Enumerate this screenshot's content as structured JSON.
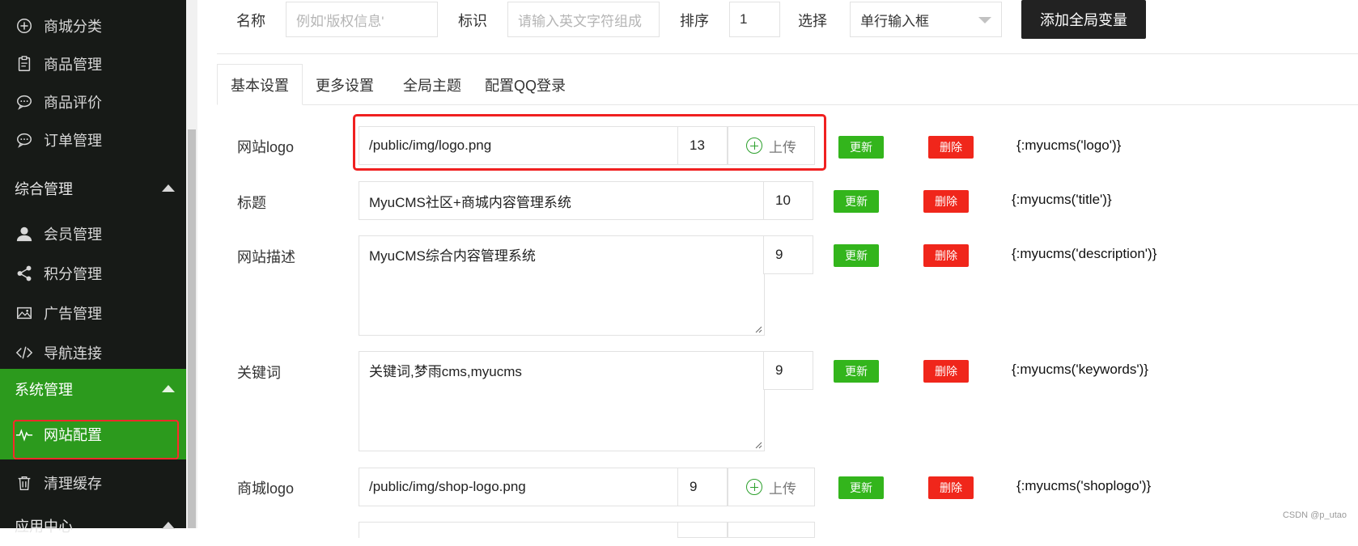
{
  "sidebar": {
    "items_top": [
      {
        "label": "商城分类",
        "icon": "plus-circle-icon"
      },
      {
        "label": "商品管理",
        "icon": "clipboard-icon"
      },
      {
        "label": "商品评价",
        "icon": "chat-bubble-icon"
      },
      {
        "label": "订单管理",
        "icon": "chat-bubble-icon"
      }
    ],
    "group_general": "综合管理",
    "items_general": [
      {
        "label": "会员管理",
        "icon": "user-icon"
      },
      {
        "label": "积分管理",
        "icon": "share-icon"
      },
      {
        "label": "广告管理",
        "icon": "image-icon"
      },
      {
        "label": "导航连接",
        "icon": "code-icon"
      }
    ],
    "group_system": "系统管理",
    "items_system": [
      {
        "label": "网站配置",
        "icon": "pulse-icon"
      },
      {
        "label": "清理缓存",
        "icon": "trash-icon"
      }
    ],
    "group_apps": "应用中心"
  },
  "topform": {
    "name_label": "名称",
    "name_placeholder": "例如'版权信息'",
    "key_label": "标识",
    "key_placeholder": "请输入英文字符组成",
    "sort_label": "排序",
    "sort_value": "1",
    "type_label": "选择",
    "type_value": "单行输入框",
    "add_button": "添加全局变量"
  },
  "tabs": [
    "基本设置",
    "更多设置",
    "全局主题",
    "配置QQ登录"
  ],
  "rows": [
    {
      "label": "网站logo",
      "value": "/public/img/logo.png",
      "sort": "13",
      "upload": "上传",
      "update": "更新",
      "delete": "删除",
      "tag": "{:myucms('logo')}"
    },
    {
      "label": "标题",
      "value": "MyuCMS社区+商城内容管理系统",
      "sort": "10",
      "update": "更新",
      "delete": "删除",
      "tag": "{:myucms('title')}"
    },
    {
      "label": "网站描述",
      "value": "MyuCMS综合内容管理系统",
      "sort": "9",
      "update": "更新",
      "delete": "删除",
      "tag": "{:myucms('description')}"
    },
    {
      "label": "关键词",
      "value": "关键词,梦雨cms,myucms",
      "sort": "9",
      "update": "更新",
      "delete": "删除",
      "tag": "{:myucms('keywords')}"
    },
    {
      "label": "商城logo",
      "value": "/public/img/shop-logo.png",
      "sort": "9",
      "upload": "上传",
      "update": "更新",
      "delete": "删除",
      "tag": "{:myucms('shoplogo')}"
    }
  ],
  "watermark": "CSDN @p_utao",
  "colors": {
    "sidebar_bg": "#171a17",
    "active_green": "#2c9a1d",
    "update_green": "#33b51c",
    "delete_red": "#f0261b",
    "highlight_red": "#f02020"
  }
}
